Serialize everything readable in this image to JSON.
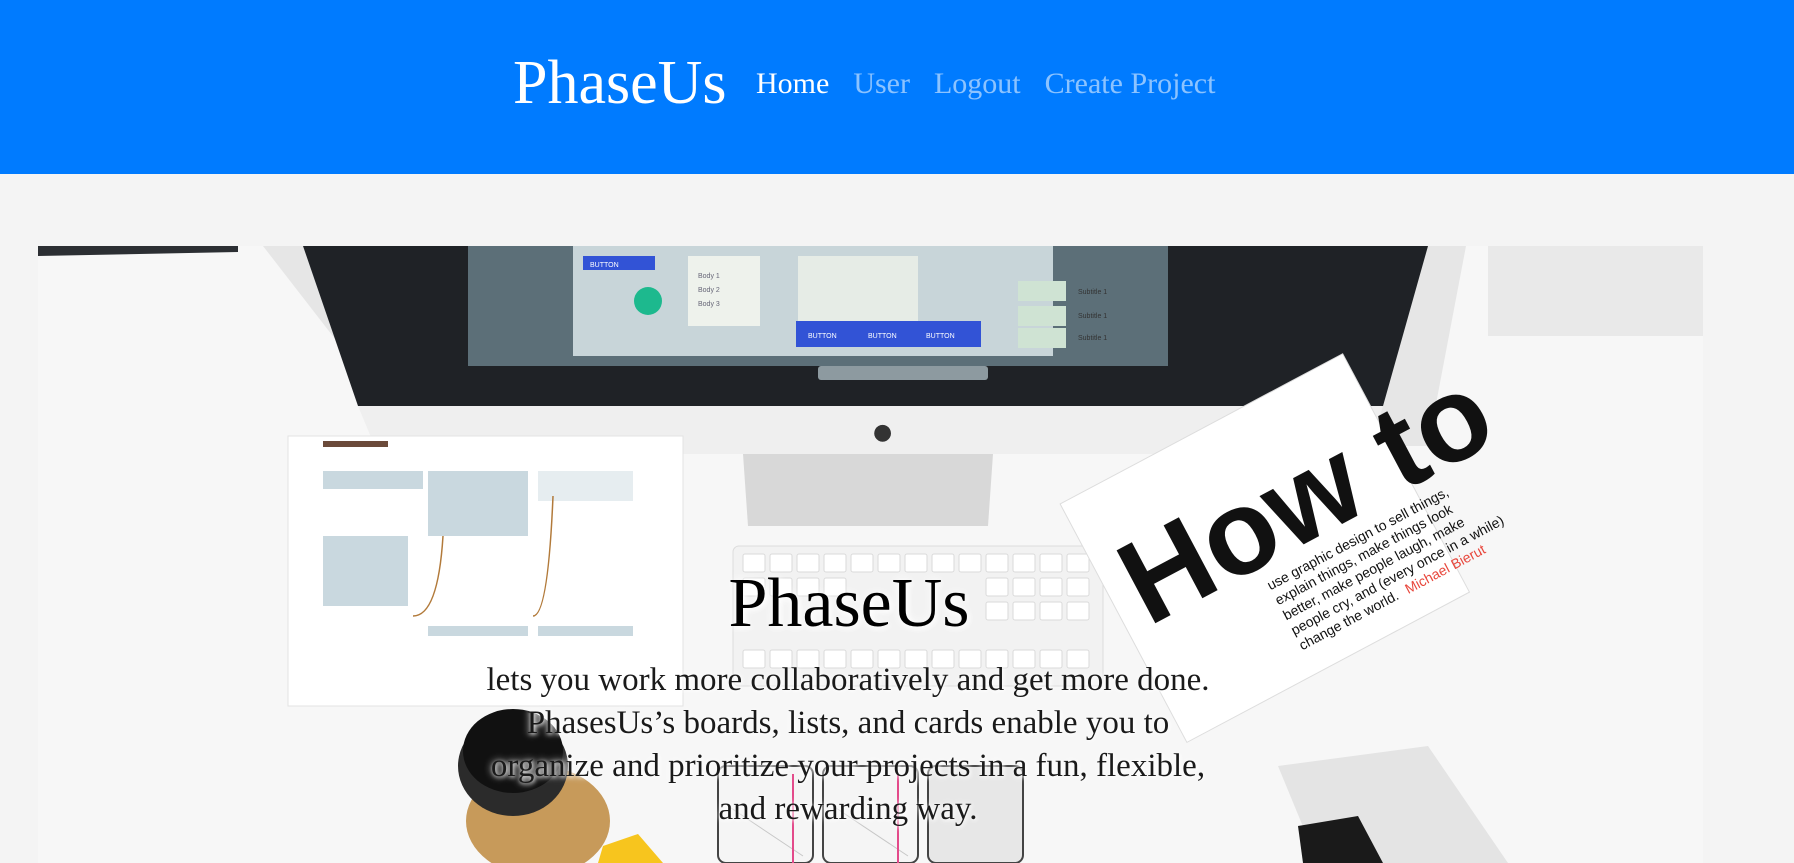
{
  "navbar": {
    "brand": "PhaseUs",
    "items": [
      {
        "label": "Home",
        "active": true
      },
      {
        "label": "User",
        "active": false
      },
      {
        "label": "Logout",
        "active": false
      },
      {
        "label": "Create Project",
        "active": false
      }
    ],
    "background_color": "#007bff"
  },
  "hero": {
    "title": "PhaseUs",
    "description_lines": [
      "lets you work more collaboratively and get more done.",
      "PhasesUs’s boards, lists, and cards enable you to",
      "organize and prioritize your projects in a fun, flexible,",
      "and rewarding way."
    ],
    "book": {
      "big_letters": "How to",
      "lines": [
        "use graphic design to sell things,",
        "explain things, make things look",
        "better, make people laugh, make",
        "people cry, and (every once in a while)",
        "change the world."
      ],
      "author": "Michael Bierut",
      "author_color": "#e8473c"
    },
    "screen_buttons": [
      "BUTTON",
      "BUTTON",
      "BUTTON",
      "BUTTON"
    ],
    "screen_list": [
      "Body 1",
      "Body 2",
      "Body 3"
    ],
    "screen_subtitles": [
      "Subtitle 1",
      "Subtitle 1",
      "Subtitle 1"
    ]
  }
}
